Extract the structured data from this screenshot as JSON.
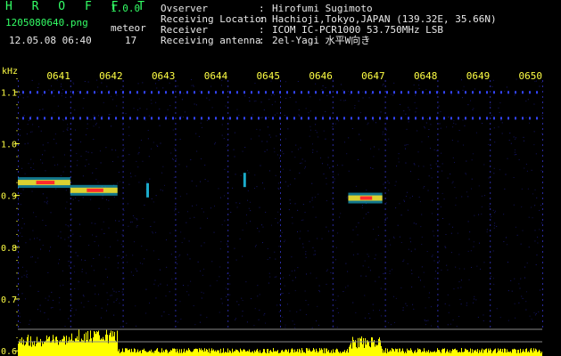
{
  "app": {
    "title": "H R O F F T",
    "version": "1.0.0"
  },
  "file": {
    "name": "1205080640.png",
    "datetime": "12.05.08 06:40"
  },
  "meteor": {
    "label": "meteor",
    "count": "17"
  },
  "info": [
    {
      "label": "Ovserver",
      "value": "Hirofumi Sugimoto"
    },
    {
      "label": "Receiving Location",
      "value": "Hachioji,Tokyo,JAPAN (139.32E, 35.66N)"
    },
    {
      "label": "Receiver",
      "value": "ICOM IC-PCR1000 53.750MHz LSB"
    },
    {
      "label": "Receiving antenna",
      "value": "2el-Yagi 水平W向き"
    }
  ],
  "colon": ":",
  "chart_data": {
    "type": "heatmap",
    "ylabel": "kHz",
    "time_ticks": [
      "0641",
      "0642",
      "0643",
      "0644",
      "0645",
      "0646",
      "0647",
      "0648",
      "0649",
      "0650"
    ],
    "freq_ticks": [
      1.1,
      1.0,
      0.9,
      0.8,
      0.7,
      0.6
    ],
    "ylim": [
      0.59,
      1.14
    ],
    "xlim_minutes": [
      0.0,
      10.0
    ],
    "echoes": [
      {
        "t_start": 0.0,
        "t_end": 1.0,
        "freq": 0.925,
        "intensity": "high"
      },
      {
        "t_start": 1.0,
        "t_end": 1.9,
        "freq": 0.91,
        "intensity": "high"
      },
      {
        "t_start": 6.3,
        "t_end": 6.95,
        "freq": 0.895,
        "intensity": "high"
      },
      {
        "t_start": 4.3,
        "t_end": 4.35,
        "freq": 0.93,
        "intensity": "low"
      },
      {
        "t_start": 2.45,
        "t_end": 2.5,
        "freq": 0.91,
        "intensity": "low"
      }
    ],
    "carrier_lines": [
      {
        "freq": 1.05
      },
      {
        "freq": 1.1
      }
    ],
    "colors": {
      "background": "#000000",
      "labels": "#ffff44",
      "grid": "#1a1a7a",
      "hot": "#ff2a2a",
      "warm": "#ffe020",
      "cool": "#22d8ff",
      "level": "#ffff00"
    }
  }
}
